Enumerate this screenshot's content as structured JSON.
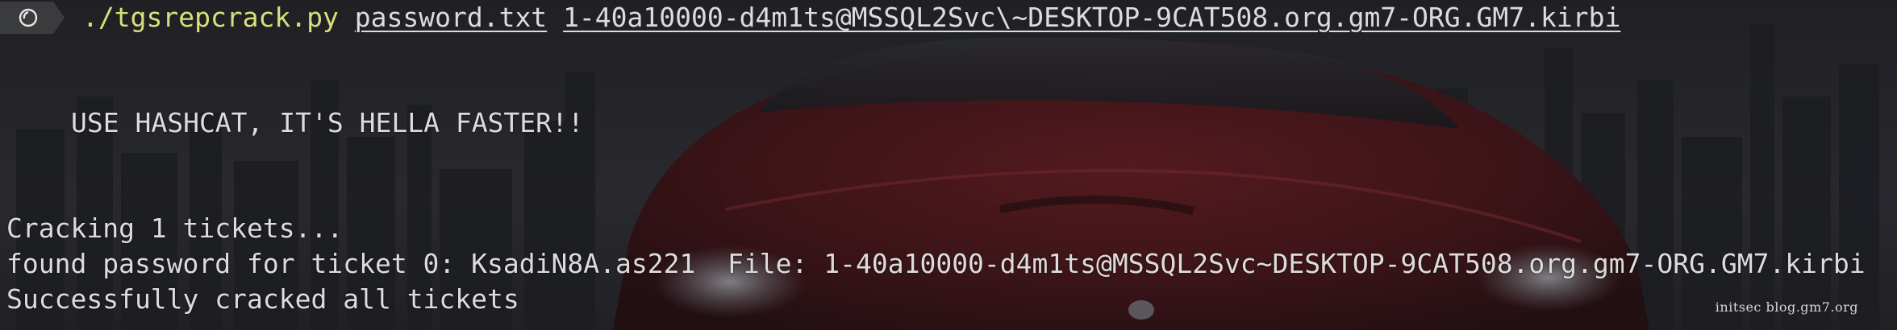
{
  "theme": {
    "exe_color": "#d9e07a",
    "text_color": "#dcdcdc",
    "badge_color": "#3a3b3d",
    "background_icon": "red-sports-car-wallpaper"
  },
  "prompt": {
    "icon": "terminal-swirl-icon",
    "command": "./tgsrepcrack.py",
    "arg1": "password.txt",
    "arg2": "1-40a10000-d4m1ts@MSSQL2Svc\\~DESKTOP-9CAT508.org.gm7-ORG.GM7.kirbi"
  },
  "output": {
    "banner": "USE HASHCAT, IT'S HELLA FASTER!!",
    "cracking": "Cracking 1 tickets...",
    "found": "found password for ticket 0: KsadiN8A.as221  File: 1-40a10000-d4m1ts@MSSQL2Svc~DESKTOP-9CAT508.org.gm7-ORG.GM7.kirbi",
    "success": "Successfully cracked all tickets"
  },
  "watermark": "initsec blog.gm7.org"
}
